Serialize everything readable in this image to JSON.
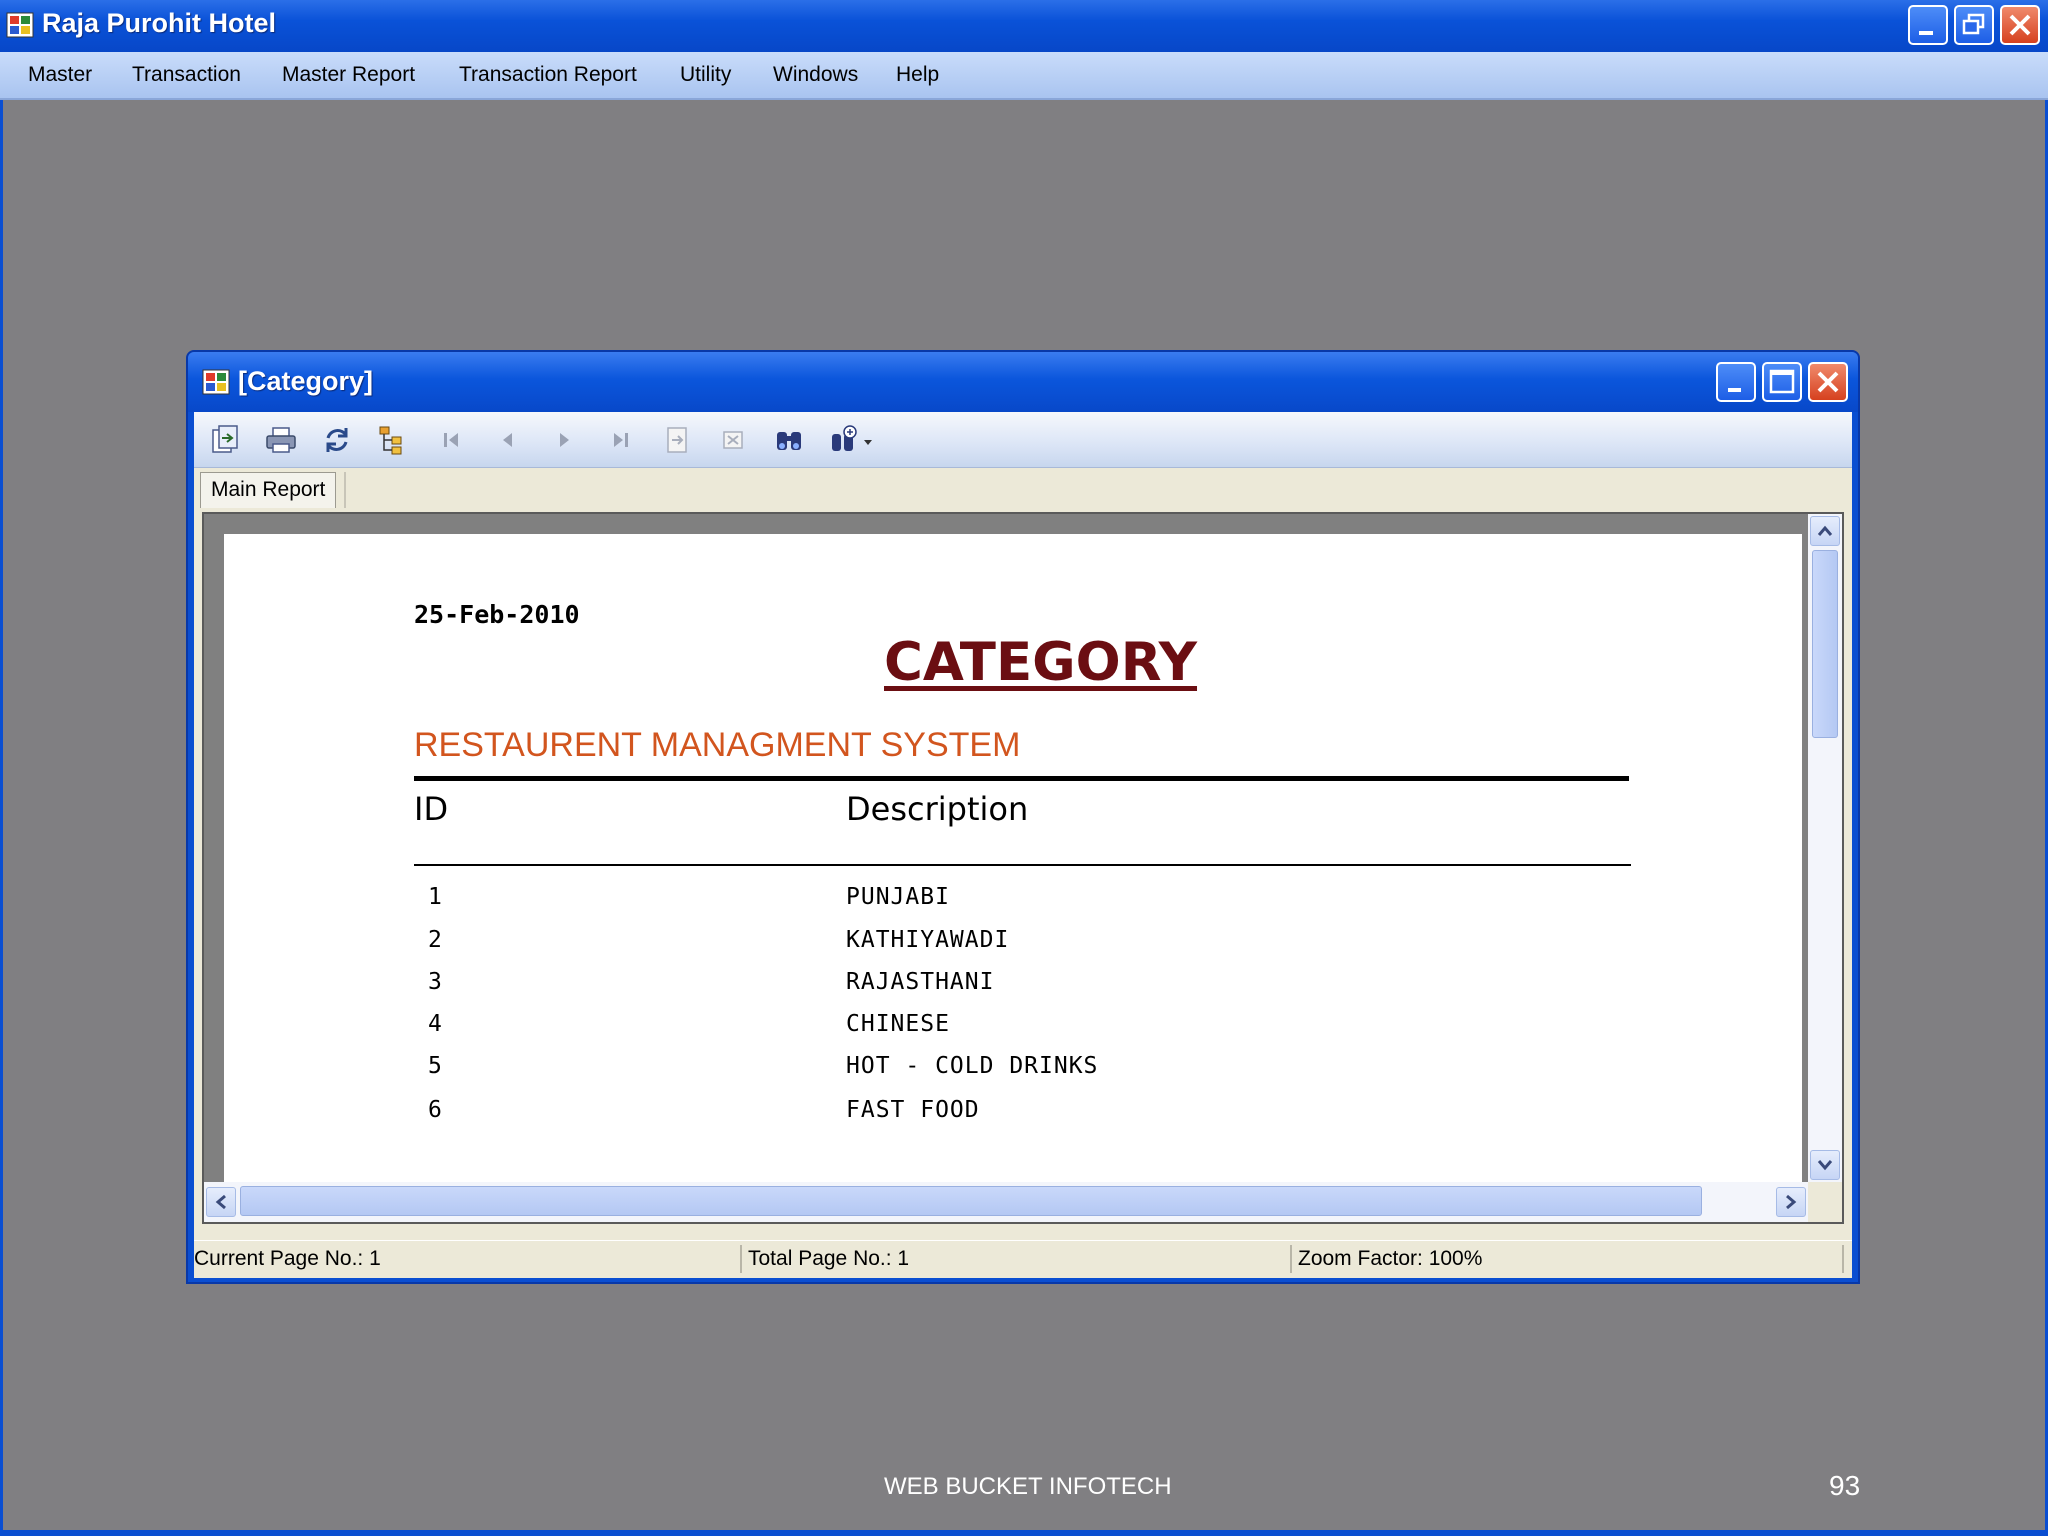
{
  "main_window": {
    "title": "Raja Purohit Hotel",
    "menu": [
      "Master",
      "Transaction",
      "Master Report",
      "Transaction Report",
      "Utility",
      "Windows",
      "Help"
    ]
  },
  "child_window": {
    "title": "[Category]",
    "toolbar_icons": [
      "export-icon",
      "print-icon",
      "refresh-icon",
      "group-tree-icon",
      "first-page-icon",
      "previous-page-icon",
      "next-page-icon",
      "last-page-icon",
      "goto-page-icon",
      "close-view-icon",
      "search-icon",
      "zoom-icon"
    ],
    "tab": "Main Report"
  },
  "report": {
    "date": "25-Feb-2010",
    "title": "CATEGORY",
    "subtitle": "RESTAURENT MANAGMENT SYSTEM",
    "columns": [
      "ID",
      "Description"
    ],
    "rows": [
      {
        "id": "1",
        "description": "PUNJABI"
      },
      {
        "id": "2",
        "description": "KATHIYAWADI"
      },
      {
        "id": "3",
        "description": "RAJASTHANI"
      },
      {
        "id": "4",
        "description": "CHINESE"
      },
      {
        "id": "5",
        "description": "HOT - COLD DRINKS"
      },
      {
        "id": "6",
        "description": "FAST FOOD"
      }
    ]
  },
  "status": {
    "current_page": "Current Page No.: 1",
    "total_page": "Total Page No.: 1",
    "zoom": "Zoom Factor: 100%"
  },
  "footer": {
    "brand": "WEB BUCKET INFOTECH",
    "page_number": "93"
  },
  "colors": {
    "title_bar": "#0a52d8",
    "report_title": "#6b0e12",
    "report_subtitle": "#d2551e",
    "desktop": "#807f82"
  }
}
